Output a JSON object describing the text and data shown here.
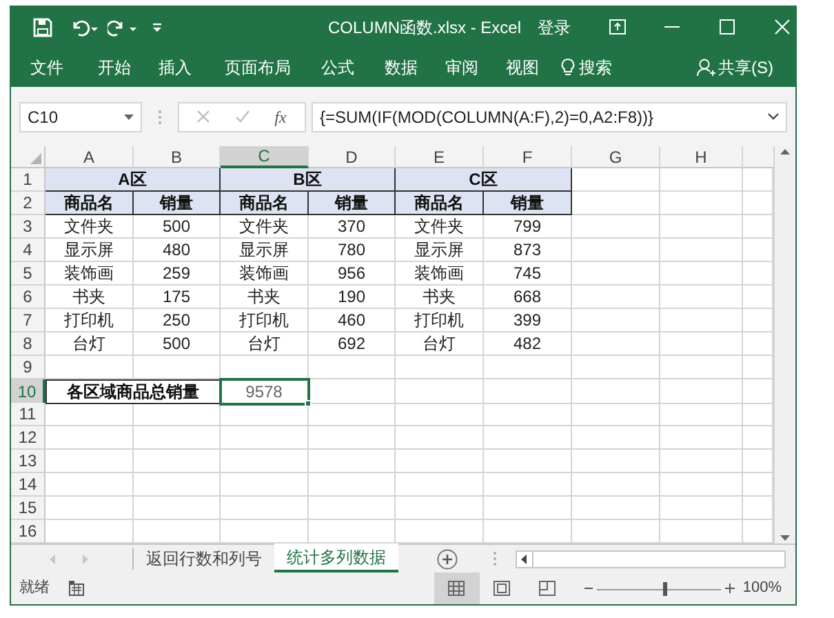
{
  "window": {
    "title": "COLUMN函数.xlsx - Excel",
    "sign_in": "登录"
  },
  "ribbon_tabs": [
    {
      "label": "文件"
    },
    {
      "label": "开始"
    },
    {
      "label": "插入"
    },
    {
      "label": "页面布局"
    },
    {
      "label": "公式"
    },
    {
      "label": "数据"
    },
    {
      "label": "审阅"
    },
    {
      "label": "视图"
    }
  ],
  "search": "搜索",
  "share": "共享(S)",
  "formula_bar": {
    "name_box": "C10",
    "function_label": "fx",
    "formula": "{=SUM(IF(MOD(COLUMN(A:F),2)=0,A2:F8))}"
  },
  "columns": [
    {
      "label": "A",
      "selected": false
    },
    {
      "label": "B",
      "selected": false
    },
    {
      "label": "C",
      "selected": true
    },
    {
      "label": "D",
      "selected": false
    },
    {
      "label": "E",
      "selected": false
    },
    {
      "label": "F",
      "selected": false
    },
    {
      "label": "G",
      "selected": false
    },
    {
      "label": "H",
      "selected": false
    }
  ],
  "rows": [
    {
      "label": "1",
      "selected": false,
      "cells": [
        {
          "text": "A区",
          "kind": "header",
          "merged": true,
          "selected": false
        },
        {
          "text": "B区",
          "kind": "header",
          "merged": true,
          "selected": false
        },
        {
          "text": "C区",
          "kind": "header",
          "merged": true,
          "selected": false
        }
      ]
    },
    {
      "label": "2",
      "selected": false,
      "cells": [
        {
          "text": "商品名",
          "kind": "header",
          "merged": false,
          "selected": false
        },
        {
          "text": "销量",
          "kind": "header",
          "merged": false,
          "selected": false
        },
        {
          "text": "商品名",
          "kind": "header",
          "merged": false,
          "selected": false
        },
        {
          "text": "销量",
          "kind": "header",
          "merged": false,
          "selected": false
        },
        {
          "text": "商品名",
          "kind": "header",
          "merged": false,
          "selected": false
        },
        {
          "text": "销量",
          "kind": "header",
          "merged": false,
          "selected": false
        }
      ]
    },
    {
      "label": "3",
      "selected": false,
      "cells": [
        {
          "text": "文件夹",
          "kind": "data",
          "merged": false,
          "selected": false
        },
        {
          "text": "500",
          "kind": "data",
          "merged": false,
          "selected": false
        },
        {
          "text": "文件夹",
          "kind": "data",
          "merged": false,
          "selected": false
        },
        {
          "text": "370",
          "kind": "data",
          "merged": false,
          "selected": false
        },
        {
          "text": "文件夹",
          "kind": "data",
          "merged": false,
          "selected": false
        },
        {
          "text": "799",
          "kind": "data",
          "merged": false,
          "selected": false
        }
      ]
    },
    {
      "label": "4",
      "selected": false,
      "cells": [
        {
          "text": "显示屏",
          "kind": "data",
          "merged": false,
          "selected": false
        },
        {
          "text": "480",
          "kind": "data",
          "merged": false,
          "selected": false
        },
        {
          "text": "显示屏",
          "kind": "data",
          "merged": false,
          "selected": false
        },
        {
          "text": "780",
          "kind": "data",
          "merged": false,
          "selected": false
        },
        {
          "text": "显示屏",
          "kind": "data",
          "merged": false,
          "selected": false
        },
        {
          "text": "873",
          "kind": "data",
          "merged": false,
          "selected": false
        }
      ]
    },
    {
      "label": "5",
      "selected": false,
      "cells": [
        {
          "text": "装饰画",
          "kind": "data",
          "merged": false,
          "selected": false
        },
        {
          "text": "259",
          "kind": "data",
          "merged": false,
          "selected": false
        },
        {
          "text": "装饰画",
          "kind": "data",
          "merged": false,
          "selected": false
        },
        {
          "text": "956",
          "kind": "data",
          "merged": false,
          "selected": false
        },
        {
          "text": "装饰画",
          "kind": "data",
          "merged": false,
          "selected": false
        },
        {
          "text": "745",
          "kind": "data",
          "merged": false,
          "selected": false
        }
      ]
    },
    {
      "label": "6",
      "selected": false,
      "cells": [
        {
          "text": "书夹",
          "kind": "data",
          "merged": false,
          "selected": false
        },
        {
          "text": "175",
          "kind": "data",
          "merged": false,
          "selected": false
        },
        {
          "text": "书夹",
          "kind": "data",
          "merged": false,
          "selected": false
        },
        {
          "text": "190",
          "kind": "data",
          "merged": false,
          "selected": false
        },
        {
          "text": "书夹",
          "kind": "data",
          "merged": false,
          "selected": false
        },
        {
          "text": "668",
          "kind": "data",
          "merged": false,
          "selected": false
        }
      ]
    },
    {
      "label": "7",
      "selected": false,
      "cells": [
        {
          "text": "打印机",
          "kind": "data",
          "merged": false,
          "selected": false
        },
        {
          "text": "250",
          "kind": "data",
          "merged": false,
          "selected": false
        },
        {
          "text": "打印机",
          "kind": "data",
          "merged": false,
          "selected": false
        },
        {
          "text": "460",
          "kind": "data",
          "merged": false,
          "selected": false
        },
        {
          "text": "打印机",
          "kind": "data",
          "merged": false,
          "selected": false
        },
        {
          "text": "399",
          "kind": "data",
          "merged": false,
          "selected": false
        }
      ]
    },
    {
      "label": "8",
      "selected": false,
      "cells": [
        {
          "text": "台灯",
          "kind": "data",
          "merged": false,
          "selected": false
        },
        {
          "text": "500",
          "kind": "data",
          "merged": false,
          "selected": false
        },
        {
          "text": "台灯",
          "kind": "data",
          "merged": false,
          "selected": false
        },
        {
          "text": "692",
          "kind": "data",
          "merged": false,
          "selected": false
        },
        {
          "text": "台灯",
          "kind": "data",
          "merged": false,
          "selected": false
        },
        {
          "text": "482",
          "kind": "data",
          "merged": false,
          "selected": false
        }
      ]
    },
    {
      "label": "9",
      "selected": false
    },
    {
      "label": "10",
      "selected": true,
      "cells": [
        {
          "text": "各区域商品总销量",
          "kind": "label",
          "merged": true,
          "selected": false
        },
        {
          "text": "9578",
          "kind": "value",
          "merged": false,
          "selected": true
        }
      ]
    },
    {
      "label": "11",
      "selected": false
    },
    {
      "label": "12",
      "selected": false
    },
    {
      "label": "13",
      "selected": false
    },
    {
      "label": "14",
      "selected": false
    },
    {
      "label": "15",
      "selected": false
    },
    {
      "label": "16",
      "selected": false
    }
  ],
  "sheet_tabs": [
    {
      "label": "返回行数和列号",
      "selected": false
    },
    {
      "label": "统计多列数据",
      "selected": true
    }
  ],
  "status_bar": {
    "text": "就绪",
    "views": [
      {
        "kind": "normal",
        "selected": true
      },
      {
        "kind": "page-layout",
        "selected": false
      },
      {
        "kind": "page-break",
        "selected": false
      }
    ],
    "zoom": {
      "level": 0.55,
      "reading": "100%"
    }
  }
}
